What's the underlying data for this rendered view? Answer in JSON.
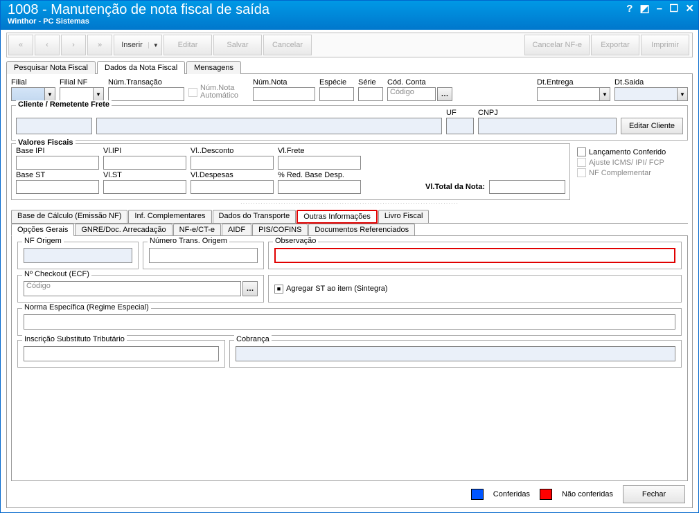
{
  "titlebar": {
    "title": "1008 - Manutenção de nota fiscal de saída",
    "subtitle": "Winthor - PC Sistemas",
    "help": "?",
    "tool": "◩",
    "min": "–",
    "max": "☐",
    "close": "✕"
  },
  "toolbar": {
    "nav_first": "⏮",
    "nav_prev": "◀",
    "nav_next": "▶",
    "nav_last": "⏭",
    "inserir": "Inserir",
    "editar": "Editar",
    "salvar": "Salvar",
    "cancelar": "Cancelar",
    "cancelar_nfe": "Cancelar NF-e",
    "exportar": "Exportar",
    "imprimir": "Imprimir"
  },
  "main_tabs": {
    "pesquisar": "Pesquisar Nota Fiscal",
    "dados": "Dados da Nota Fiscal",
    "mensagens": "Mensagens"
  },
  "fields": {
    "filial": "Filial",
    "filial_nf": "Filial NF",
    "num_transacao": "Núm.Transação",
    "num_nota_auto_chk": "Núm.Nota Automático",
    "num_nota": "Núm.Nota",
    "especie": "Espécie",
    "serie": "Série",
    "cod_conta": "Cód. Conta",
    "cod_conta_placeholder": "Código",
    "dt_entrega": "Dt.Entrega",
    "dt_saida": "Dt.Saida"
  },
  "cliente": {
    "group": "Cliente / Remetente Frete",
    "uf": "UF",
    "cnpj": "CNPJ",
    "editar": "Editar Cliente"
  },
  "valores": {
    "group": "Valores Fiscais",
    "base_ipi": "Base IPI",
    "vl_ipi": "Vl.IPI",
    "vl_desconto": "Vl..Desconto",
    "vl_frete": "Vl.Frete",
    "base_st": "Base ST",
    "vl_st": "Vl.ST",
    "vl_despesas": "Vl.Despesas",
    "red_base": "% Red. Base Desp.",
    "total": "Vl.Total da Nota:"
  },
  "checks": {
    "lanc_conferido": "Lançamento Conferido",
    "ajuste": "Ajuste ICMS/ IPI/ FCP",
    "nf_comp": "NF Complementar"
  },
  "subtabs1": {
    "base_calc": "Base de Cálculo (Emissão NF)",
    "inf_comp": "Inf. Complementares",
    "dados_transp": "Dados do Transporte",
    "outras": "Outras Informações",
    "livro": "Livro Fiscal"
  },
  "subtabs2": {
    "opcoes": "Opções Gerais",
    "gnre": "GNRE/Doc. Arrecadação",
    "nfe": "NF-e/CT-e",
    "aidf": "AIDF",
    "pis": "PIS/COFINS",
    "doc_ref": "Documentos Referenciados"
  },
  "opcoes": {
    "nf_origem": "NF Origem",
    "num_trans_origem": "Número Trans. Origem",
    "observacao": "Observação",
    "checkout": "Nº Checkout (ECF)",
    "checkout_placeholder": "Código",
    "agregar": "Agregar ST ao item (Sintegra)",
    "norma": "Norma Específica (Regime Especial)",
    "inscricao": "Inscrição Substituto Tributário",
    "cobranca": "Cobrança"
  },
  "footer": {
    "conferidas": "Conferidas",
    "nao_conferidas": "Não conferidas",
    "fechar": "Fechar"
  }
}
